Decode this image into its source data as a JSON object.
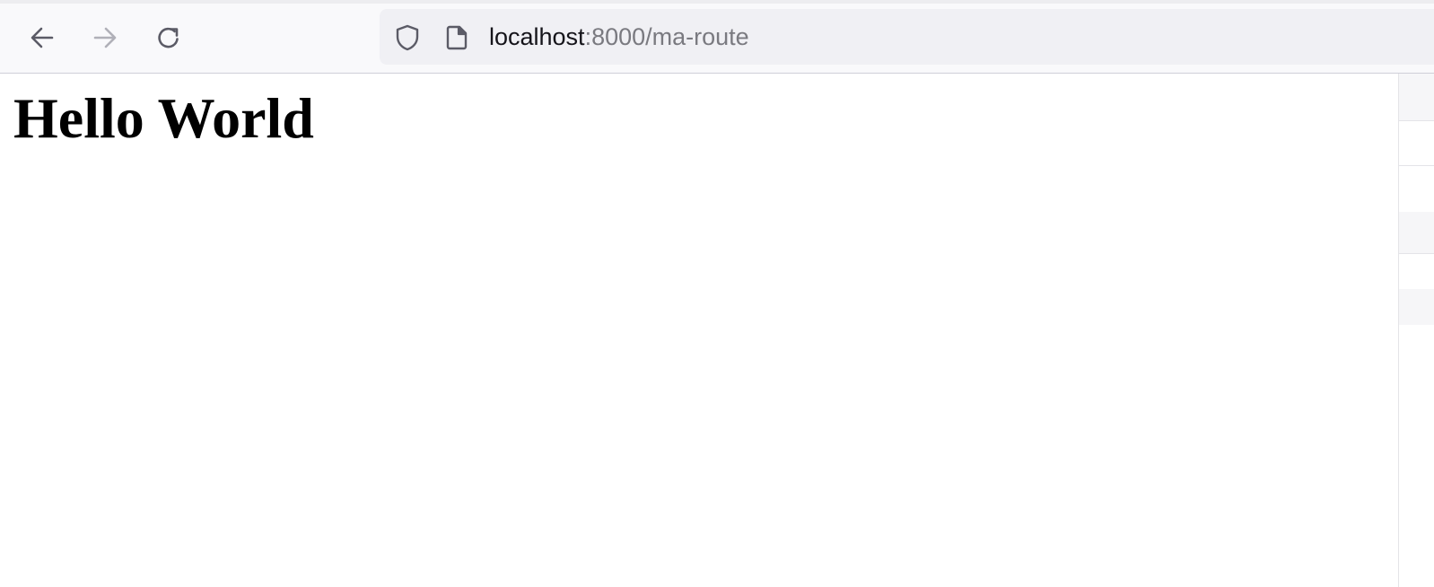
{
  "browser": {
    "nav": {
      "back": "arrow-left-icon",
      "forward": "arrow-right-icon",
      "reload": "reload-icon"
    },
    "urlbar": {
      "security_icon": "shield-icon",
      "page_icon": "document-icon",
      "url_host": "localhost",
      "url_rest": ":8000/ma-route"
    }
  },
  "page": {
    "heading": "Hello World"
  },
  "colors": {
    "toolbar_bg": "#f9f9fb",
    "urlbar_bg": "#f0f0f4",
    "url_host_text": "#15141a",
    "url_rest_text": "#7a7a80",
    "icon_active": "#5b5b66",
    "icon_disabled": "#b0b0b8"
  }
}
